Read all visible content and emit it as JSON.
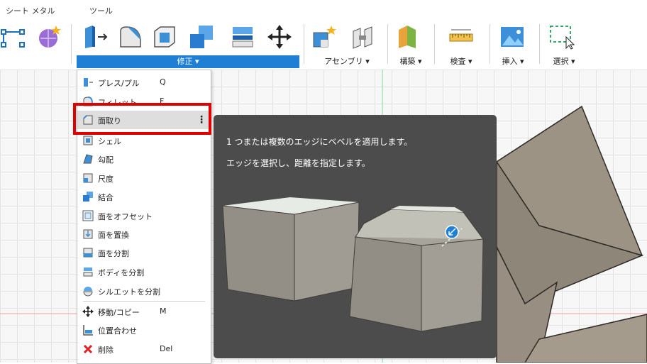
{
  "tabs": [
    "シート メタル",
    "ツール"
  ],
  "groups": {
    "modify": "修正 ▾",
    "assemble": "アセンブリ ▾",
    "construct": "構築 ▾",
    "inspect": "検査 ▾",
    "insert": "挿入 ▾",
    "select": "選択 ▾"
  },
  "menu": {
    "items": [
      {
        "label": "プレス/プル",
        "shortcut": "Q"
      },
      {
        "label": "フィレット",
        "shortcut": "F"
      },
      {
        "label": "面取り",
        "shortcut": ""
      },
      {
        "label": "シェル",
        "shortcut": ""
      },
      {
        "label": "勾配",
        "shortcut": ""
      },
      {
        "label": "尺度",
        "shortcut": ""
      },
      {
        "label": "結合",
        "shortcut": ""
      },
      {
        "label": "面をオフセット",
        "shortcut": ""
      },
      {
        "label": "面を置換",
        "shortcut": ""
      },
      {
        "label": "面を分割",
        "shortcut": ""
      },
      {
        "label": "ボディを分割",
        "shortcut": ""
      },
      {
        "label": "シルエットを分割",
        "shortcut": ""
      },
      {
        "label": "移動/コピー",
        "shortcut": "M"
      },
      {
        "label": "位置合わせ",
        "shortcut": ""
      },
      {
        "label": "削除",
        "shortcut": "Del"
      }
    ],
    "more_glyph": "⋮"
  },
  "tooltip": {
    "line1": "1 つまたは複数のエッジにベベルを適用します。",
    "line2": "エッジを選択し、距離を指定します。"
  },
  "colors": {
    "accent": "#1f7fd4",
    "highlight_box": "#e00000",
    "tooltip_bg": "#4c4c4c"
  }
}
